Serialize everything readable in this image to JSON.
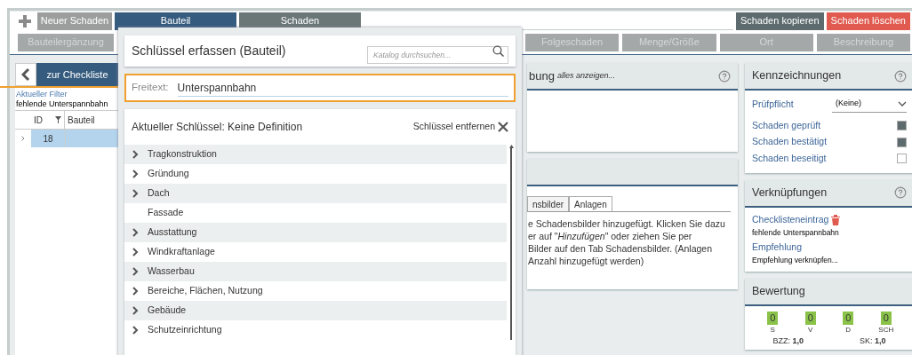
{
  "toolbar": {
    "new_button": "Neuer Schaden",
    "tabs": [
      {
        "label": "Bauteil",
        "selected": true
      },
      {
        "label": "Schaden",
        "selected": false
      }
    ],
    "copy_button": "Schaden kopieren",
    "delete_button": "Schaden löschen"
  },
  "subtabs": {
    "left": "Bauteilergänzung",
    "right": [
      "Folgeschaden",
      "Menge/Größe",
      "Ort",
      "Beschreibung"
    ]
  },
  "left_panel": {
    "back_button": "zur Checkliste",
    "filter_label": "Aktueller Filter",
    "filter_value": "fehlende Unterspannbahn",
    "columns": [
      "ID",
      "Bauteil"
    ],
    "rows": [
      {
        "id": "18",
        "bauteil": "",
        "selected": true
      }
    ]
  },
  "center": {
    "title_fragment": "bung",
    "show_all_link": "alles anzeigen...",
    "tabs": [
      {
        "label": "nsbilder",
        "selected": false
      },
      {
        "label": "Anlagen",
        "selected": true
      }
    ],
    "message_lines": [
      "e Schadensbilder hinzugefügt. Klicken Sie dazu",
      "er auf \"*Hinzufügen*\" oder ziehen Sie per",
      "Bilder auf den Tab Schadensbilder. (Anlagen",
      "Anzahl hinzugefügt werden)"
    ]
  },
  "kennzeichnungen": {
    "title": "Kennzeichnungen",
    "pruefpflicht_label": "Prüfpflicht",
    "pruefpflicht_value": "(Keine)",
    "flags": [
      {
        "label": "Schaden geprüft",
        "checked": true
      },
      {
        "label": "Schaden bestätigt",
        "checked": true
      },
      {
        "label": "Schaden beseitigt",
        "checked": false
      }
    ]
  },
  "verknuepfungen": {
    "title": "Verknüpfungen",
    "links": [
      {
        "label": "Checklisteneintrag",
        "value": "fehlende Unterspannbahn",
        "deletable": true
      },
      {
        "label": "Empfehlung",
        "value": "Empfehlung verknüpfen...",
        "deletable": false
      }
    ]
  },
  "bewertung": {
    "title": "Bewertung",
    "scores": [
      {
        "value": "0",
        "label": "S"
      },
      {
        "value": "0",
        "label": "V"
      },
      {
        "value": "0",
        "label": "D"
      },
      {
        "value": "0",
        "label": "SCH"
      }
    ],
    "totals": [
      "BZZ: **1,0**",
      "SK: **1,0**"
    ]
  },
  "dialog": {
    "title": "Schlüssel erfassen (Bauteil)",
    "search_placeholder": "Katalog durchsuchen...",
    "freitext_label": "Freitext:",
    "freitext_value": "Unterspannbahn",
    "current_key": "Aktueller Schlüssel: Keine Definition",
    "remove_key": "Schlüssel entfernen",
    "items": [
      {
        "label": "Tragkonstruktion",
        "expandable": true
      },
      {
        "label": "Gründung",
        "expandable": true
      },
      {
        "label": "Dach",
        "expandable": true
      },
      {
        "label": "Fassade",
        "expandable": false
      },
      {
        "label": "Ausstattung",
        "expandable": true
      },
      {
        "label": "Windkraftanlage",
        "expandable": true
      },
      {
        "label": "Wasserbau",
        "expandable": true
      },
      {
        "label": "Bereiche, Flächen, Nutzung",
        "expandable": true
      },
      {
        "label": "Gebäude",
        "expandable": true
      },
      {
        "label": "Schutzeinrichtung",
        "expandable": true
      }
    ]
  }
}
